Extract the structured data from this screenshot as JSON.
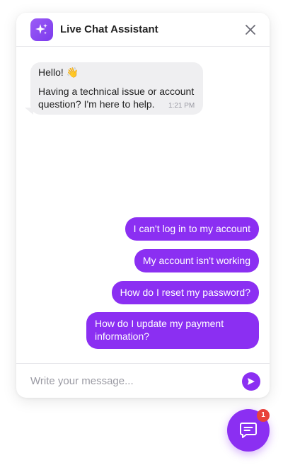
{
  "header": {
    "title": "Live Chat Assistant",
    "avatar_icon": "sparkle-icon",
    "close_icon": "close-icon"
  },
  "messages": {
    "bot": {
      "greeting": "Hello! 👋",
      "text": "Having a technical issue or account question? I'm here to help.",
      "time": "1:21 PM"
    },
    "user": [
      "I can't log in to my account",
      "My account isn't working",
      "How do I reset my password?",
      "How do I update my payment information?"
    ]
  },
  "composer": {
    "placeholder": "Write your message...",
    "send_icon": "send-icon"
  },
  "launcher": {
    "icon": "chat-icon",
    "badge_count": "1"
  },
  "colors": {
    "accent": "#8b2ff2",
    "bot_bubble": "#efeff1",
    "badge": "#e8423b"
  }
}
